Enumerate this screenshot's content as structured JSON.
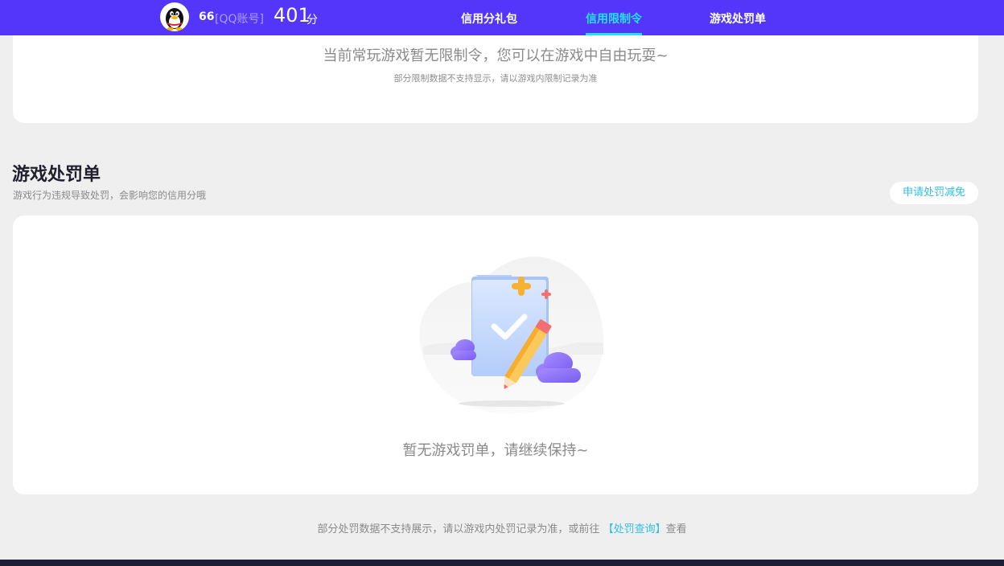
{
  "header": {
    "username": "66",
    "account_type": "[QQ账号]",
    "score": "401",
    "score_unit": "分",
    "nav": [
      "信用分礼包",
      "信用限制令",
      "游戏处罚单"
    ],
    "active_tab": "信用限制令"
  },
  "restriction_card": {
    "message": "当前常玩游戏暂无限制令，您可以在游戏中自由玩耍~",
    "note": "部分限制数据不支持显示，请以游戏内限制记录为准"
  },
  "penalty_section": {
    "title": "游戏处罚单",
    "subtitle": "游戏行为违规导致处罚，会影响您的信用分哦",
    "appeal_button": "申请处罚减免",
    "empty_text": "暂无游戏罚单，请继续保持~"
  },
  "footer": {
    "note_prefix": "部分处罚数据不支持展示，请以游戏内处罚记录为准，或前往",
    "link_text": "【处罚查询】",
    "note_suffix": "查看"
  },
  "colors": {
    "header_bg": "#5436fb",
    "accent": "#22e3f0",
    "link": "#30c0e3",
    "page_bg": "#efefef"
  },
  "icons": {
    "avatar": "qq-penguin-avatar",
    "illustration": "empty-folder-check-pencil-illustration"
  }
}
